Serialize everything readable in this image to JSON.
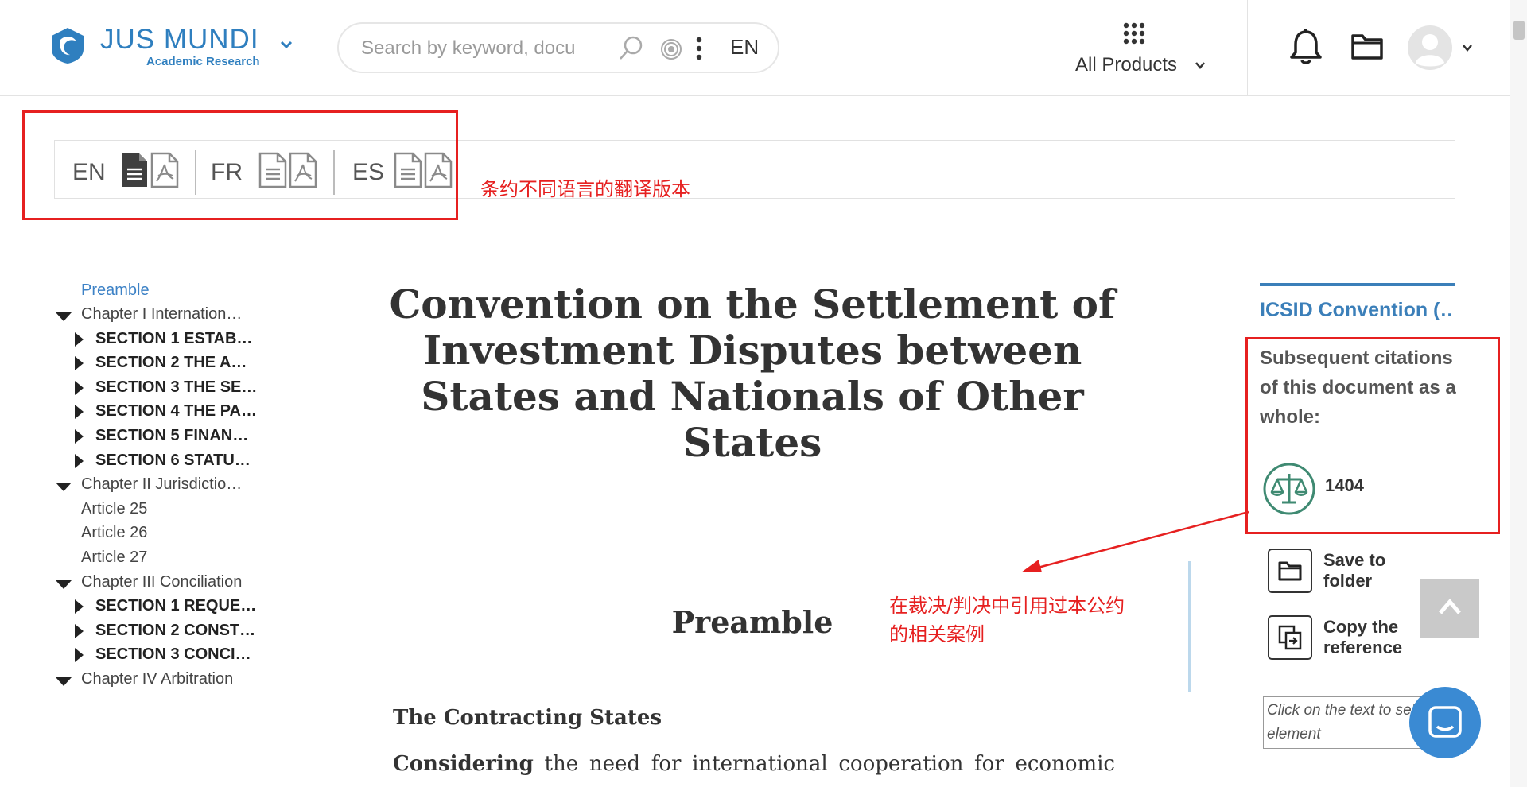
{
  "header": {
    "logo_title": "JUS MUNDI",
    "logo_subtitle": "Academic Research",
    "search_placeholder": "Search by keyword, docu",
    "search_language": "EN",
    "products_label": "All Products"
  },
  "language_versions": [
    {
      "code": "EN",
      "doc_active": true
    },
    {
      "code": "FR",
      "doc_active": false
    },
    {
      "code": "ES",
      "doc_active": false
    }
  ],
  "annotations": {
    "language_note": "条约不同语言的翻译版本",
    "citation_note_line1": "在裁决/判决中引用过本公约",
    "citation_note_line2": "的相关案例"
  },
  "toc": {
    "preamble": "Preamble",
    "items": [
      {
        "type": "chapter",
        "label": "Chapter I Internation…"
      },
      {
        "type": "section",
        "label": "SECTION 1 ESTAB…"
      },
      {
        "type": "section",
        "label": "SECTION 2 THE A…"
      },
      {
        "type": "section",
        "label": "SECTION 3 THE SE…"
      },
      {
        "type": "section",
        "label": "SECTION 4 THE PA…"
      },
      {
        "type": "section",
        "label": "SECTION 5 FINAN…"
      },
      {
        "type": "section",
        "label": "SECTION 6 STATU…"
      },
      {
        "type": "chapter",
        "label": "Chapter II Jurisdictio…"
      },
      {
        "type": "article",
        "label": "Article 25"
      },
      {
        "type": "article",
        "label": "Article 26"
      },
      {
        "type": "article",
        "label": "Article 27"
      },
      {
        "type": "chapter",
        "label": "Chapter III Conciliation"
      },
      {
        "type": "section",
        "label": "SECTION 1 REQUE…"
      },
      {
        "type": "section",
        "label": "SECTION 2 CONST…"
      },
      {
        "type": "section",
        "label": "SECTION 3 CONCI…"
      },
      {
        "type": "chapter",
        "label": "Chapter IV Arbitration"
      }
    ]
  },
  "document": {
    "title": "Convention on the Settlement of Investment Disputes between States and Nationals of Other States",
    "preamble_heading": "Preamble",
    "contracting_states": "The Contracting States",
    "considering_bold": "Considering",
    "considering_rest": " the need for international cooperation for economic"
  },
  "sidebar": {
    "title": "ICSID Convention (…",
    "citations_text": "Subsequent citations of this document as a whole:",
    "citations_count": "1404",
    "save_label": "Save to folder",
    "copy_label": "Copy the reference",
    "hint_text": "Click on the text to sel an element"
  }
}
